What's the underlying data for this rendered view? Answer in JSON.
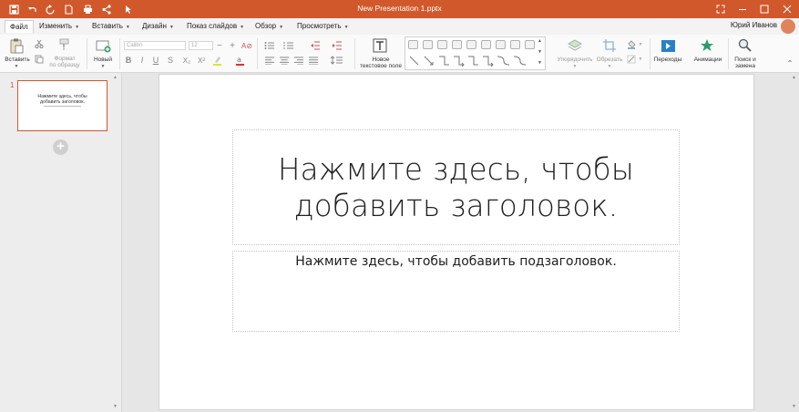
{
  "window": {
    "title": "New Presentation 1.pptx",
    "quick_access": [
      "save-icon",
      "undo-icon",
      "redo-icon",
      "new-document-icon",
      "print-icon",
      "share-icon",
      "touch-mode-icon"
    ],
    "controls": [
      "restore-icon",
      "minimize-icon",
      "maximize-icon",
      "close-icon"
    ],
    "accent_color": "#d0582b"
  },
  "menu": {
    "items": [
      {
        "label": "Файл",
        "active": true
      },
      {
        "label": "Изменить"
      },
      {
        "label": "Вставить"
      },
      {
        "label": "Дизайн"
      },
      {
        "label": "Показ слайдов"
      },
      {
        "label": "Обзор"
      },
      {
        "label": "Просмотреть"
      }
    ],
    "user_name": "Юрий Иванов"
  },
  "ribbon": {
    "paste": "Вставить",
    "format_painter": [
      "Формат",
      "по образцу"
    ],
    "new_slide": "Новый",
    "font_name": "Calibri",
    "font_size": "12",
    "format_buttons": [
      "B",
      "I",
      "U",
      "S",
      "X₂",
      "X²"
    ],
    "text_box": [
      "Новое",
      "текстовое поле"
    ],
    "arrange": "Упорядочить",
    "crop": "Обрезать",
    "transitions": "Переходы",
    "animations": "Анимации",
    "find_replace": [
      "Поиск и",
      "замена"
    ]
  },
  "slides_panel": {
    "slide_number": "1",
    "thumb_title": [
      "Нажмите здесь, чтобы",
      "добавить заголовок."
    ]
  },
  "slide": {
    "title_line1": "Нажмите здесь, чтобы",
    "title_line2": "добавить заголовок.",
    "subtitle": "Нажмите здесь, чтобы добавить подзаголовок."
  }
}
